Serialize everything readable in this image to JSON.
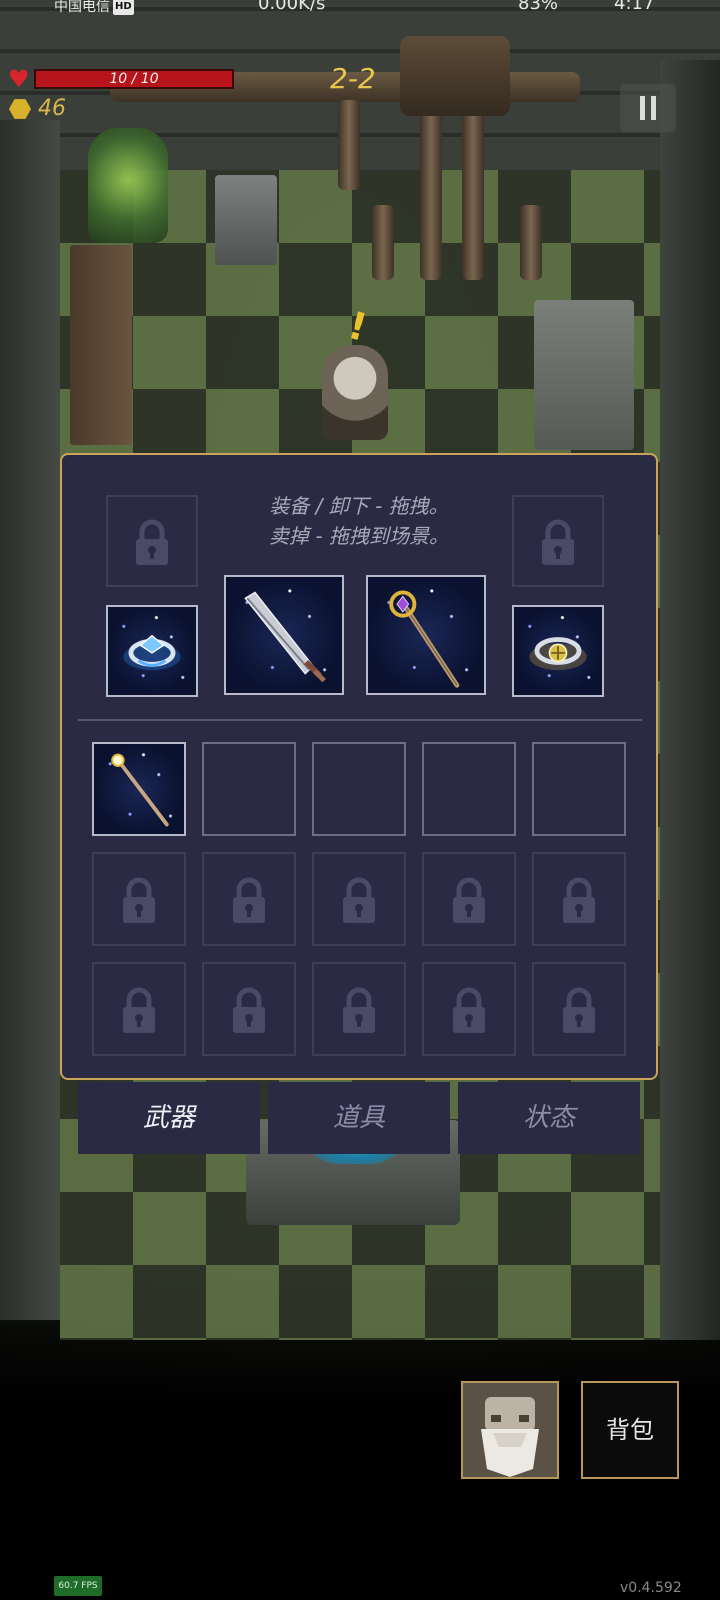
{
  "statusbar": {
    "carrier": "中国电信",
    "hd": "HD",
    "speed": "0.00K/s",
    "battery": "83%",
    "time": "4:17"
  },
  "hud": {
    "hp_text": "10 / 10",
    "hp_fraction": 1.0,
    "coins": "46",
    "level": "2-2",
    "colors": {
      "hp": "#b8141c",
      "coin": "#d8b12a",
      "level": "#e7c64c"
    }
  },
  "inventory": {
    "instructions_line1": "装备 / 卸下 - 拖拽。",
    "instructions_line2": "卖掉 - 拖拽到场景。",
    "equipment_slots": [
      {
        "slot": "accessory-top-left",
        "state": "locked"
      },
      {
        "slot": "accessory-top-right",
        "state": "locked"
      },
      {
        "slot": "ring-left",
        "state": "filled",
        "item": "blue-ring"
      },
      {
        "slot": "weapon-main",
        "state": "filled",
        "item": "broadsword"
      },
      {
        "slot": "weapon-off",
        "state": "filled",
        "item": "amethyst-staff"
      },
      {
        "slot": "ring-right",
        "state": "filled",
        "item": "gold-ring"
      }
    ],
    "bag_grid": [
      [
        "wand",
        "empty",
        "empty",
        "empty",
        "empty"
      ],
      [
        "locked",
        "locked",
        "locked",
        "locked",
        "locked"
      ],
      [
        "locked",
        "locked",
        "locked",
        "locked",
        "locked"
      ]
    ],
    "colors": {
      "panel": "#2b2a45",
      "border": "#c9a35a"
    }
  },
  "tabs": [
    {
      "label": "武器",
      "active": true
    },
    {
      "label": "道具",
      "active": false
    },
    {
      "label": "状态",
      "active": false
    }
  ],
  "bottom": {
    "bag_label": "背包",
    "fps": "60.7 FPS",
    "version": "v0.4.592"
  }
}
